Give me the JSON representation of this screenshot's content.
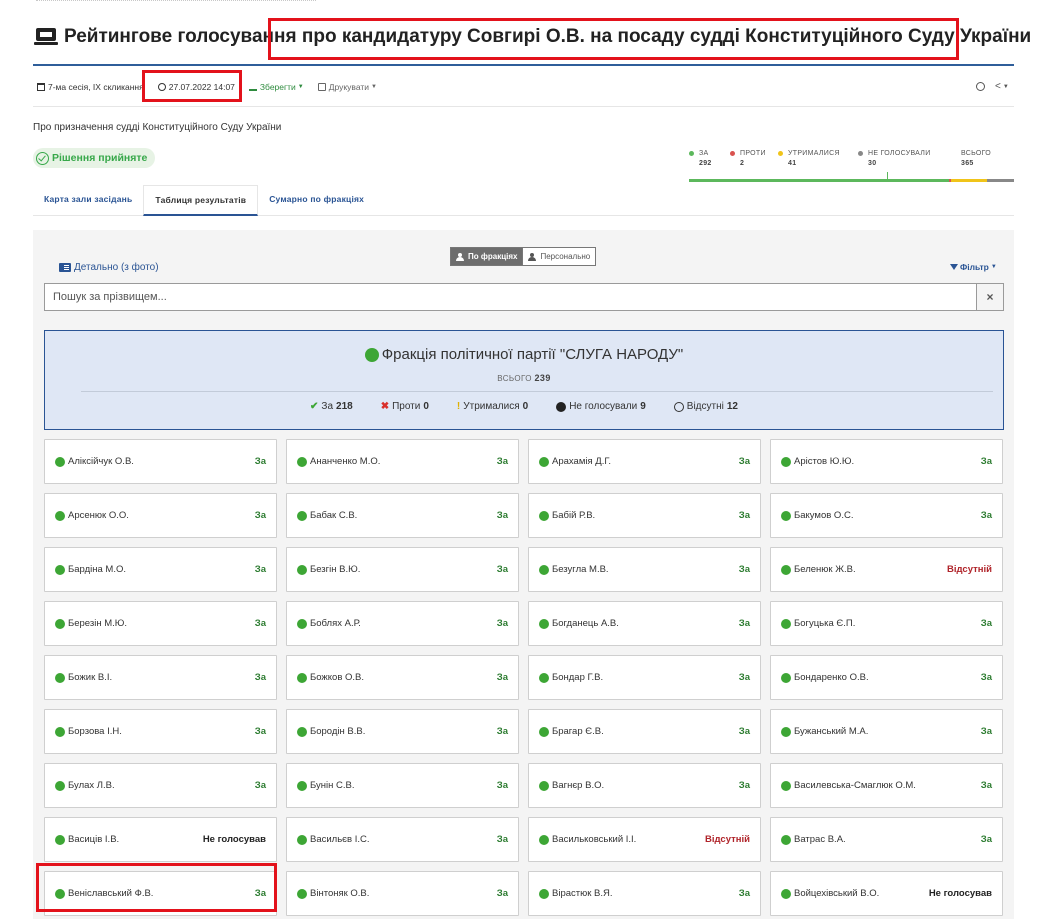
{
  "header": {
    "title": "Рейтингове голосування про кандидатуру Совгирі О.В. на посаду судді Конституційного Суду України"
  },
  "meta": {
    "session": "7-ма сесія, IX скликання",
    "datetime": "27.07.2022 14:07",
    "save_label": "Зберегти",
    "print_label": "Друкувати"
  },
  "subject": "Про призначення судді Конституційного Суду України",
  "decision": "Рішення прийняте",
  "summary": {
    "for_label": "За",
    "for_value": "292",
    "against_label": "Проти",
    "against_value": "2",
    "abstain_label": "Утрималися",
    "abstain_value": "41",
    "novote_label": "Не голосували",
    "novote_value": "30",
    "total_label": "Всього",
    "total_value": "365",
    "colors": {
      "for": "#5cb85c",
      "against": "#d9534f",
      "abstain": "#f0c419",
      "novote": "#888888"
    }
  },
  "tabs": [
    "Карта зали засідань",
    "Таблиця результатів",
    "Сумарно по фракціях"
  ],
  "panel": {
    "by_faction_label": "По фракціях",
    "personal_label": "Персонально",
    "detail_label": "Детально (з фото)",
    "filter_label": "Фільтр",
    "search_placeholder": "Пошук за прізвищем...",
    "clear_label": "×"
  },
  "faction": {
    "name": "Фракція політичної партії \"СЛУГА НАРОДУ\"",
    "total_label": "ВСЬОГО",
    "total_value": "239",
    "stats": {
      "for_label": "За",
      "for_value": "218",
      "against_label": "Проти",
      "against_value": "0",
      "abstain_label": "Утрималися",
      "abstain_value": "0",
      "novote_label": "Не голосували",
      "novote_value": "9",
      "absent_label": "Відсутні",
      "absent_value": "12"
    }
  },
  "deputies": [
    {
      "name": "Аліксійчук О.В.",
      "vote": "За",
      "kind": "for"
    },
    {
      "name": "Ананченко М.О.",
      "vote": "За",
      "kind": "for"
    },
    {
      "name": "Арахамія Д.Г.",
      "vote": "За",
      "kind": "for"
    },
    {
      "name": "Арістов Ю.Ю.",
      "vote": "За",
      "kind": "for"
    },
    {
      "name": "Арсенюк О.О.",
      "vote": "За",
      "kind": "for"
    },
    {
      "name": "Бабак С.В.",
      "vote": "За",
      "kind": "for"
    },
    {
      "name": "Бабій Р.В.",
      "vote": "За",
      "kind": "for"
    },
    {
      "name": "Бакумов О.С.",
      "vote": "За",
      "kind": "for"
    },
    {
      "name": "Бардіна М.О.",
      "vote": "За",
      "kind": "for"
    },
    {
      "name": "Безгін В.Ю.",
      "vote": "За",
      "kind": "for"
    },
    {
      "name": "Безугла М.В.",
      "vote": "За",
      "kind": "for"
    },
    {
      "name": "Беленюк Ж.В.",
      "vote": "Відсутній",
      "kind": "absent"
    },
    {
      "name": "Березін М.Ю.",
      "vote": "За",
      "kind": "for"
    },
    {
      "name": "Боблях А.Р.",
      "vote": "За",
      "kind": "for"
    },
    {
      "name": "Богданець А.В.",
      "vote": "За",
      "kind": "for"
    },
    {
      "name": "Богуцька Є.П.",
      "vote": "За",
      "kind": "for"
    },
    {
      "name": "Божик В.І.",
      "vote": "За",
      "kind": "for"
    },
    {
      "name": "Божков О.В.",
      "vote": "За",
      "kind": "for"
    },
    {
      "name": "Бондар Г.В.",
      "vote": "За",
      "kind": "for"
    },
    {
      "name": "Бондаренко О.В.",
      "vote": "За",
      "kind": "for"
    },
    {
      "name": "Борзова І.Н.",
      "vote": "За",
      "kind": "for"
    },
    {
      "name": "Бородін В.В.",
      "vote": "За",
      "kind": "for"
    },
    {
      "name": "Брагар Є.В.",
      "vote": "За",
      "kind": "for"
    },
    {
      "name": "Бужанський М.А.",
      "vote": "За",
      "kind": "for"
    },
    {
      "name": "Булах Л.В.",
      "vote": "За",
      "kind": "for"
    },
    {
      "name": "Бунін С.В.",
      "vote": "За",
      "kind": "for"
    },
    {
      "name": "Вагнєр В.О.",
      "vote": "За",
      "kind": "for"
    },
    {
      "name": "Василевська-Смаглюк О.М.",
      "vote": "За",
      "kind": "for"
    },
    {
      "name": "Васиців І.В.",
      "vote": "Не голосував",
      "kind": "nv"
    },
    {
      "name": "Васильєв І.С.",
      "vote": "За",
      "kind": "for"
    },
    {
      "name": "Васильковський І.І.",
      "vote": "Відсутній",
      "kind": "absent"
    },
    {
      "name": "Ватрас В.А.",
      "vote": "За",
      "kind": "for"
    },
    {
      "name": "Веніславський Ф.В.",
      "vote": "За",
      "kind": "for"
    },
    {
      "name": "Вінтоняк О.В.",
      "vote": "За",
      "kind": "for"
    },
    {
      "name": "Вірастюк В.Я.",
      "vote": "За",
      "kind": "for"
    },
    {
      "name": "Войцехівський В.О.",
      "vote": "Не голосував",
      "kind": "nv"
    }
  ]
}
